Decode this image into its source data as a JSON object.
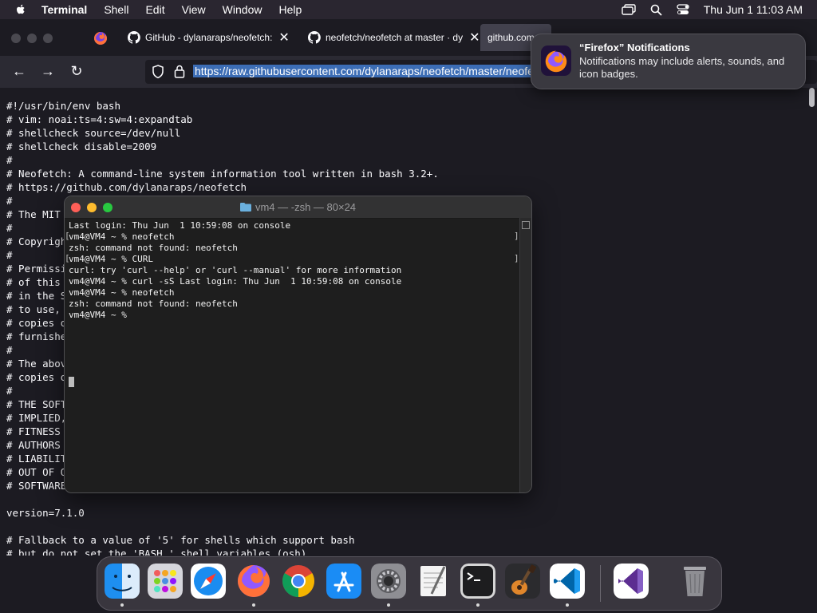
{
  "menubar": {
    "app": "Terminal",
    "items": [
      "Shell",
      "Edit",
      "View",
      "Window",
      "Help"
    ],
    "clock": "Thu Jun 1  11:03 AM"
  },
  "tabs": [
    {
      "label": "GitHub - dylanaraps/neofetch:",
      "active": false
    },
    {
      "label": "neofetch/neofetch at master · dy",
      "active": false
    },
    {
      "label": "github.com",
      "active": true
    }
  ],
  "nav": {
    "url": "https://raw.githubusercontent.com/dylanaraps/neofetch/master/neofetch"
  },
  "page": {
    "code": "#!/usr/bin/env bash\n# vim: noai:ts=4:sw=4:expandtab\n# shellcheck source=/dev/null\n# shellcheck disable=2009\n#\n# Neofetch: A command-line system information tool written in bash 3.2+.\n# https://github.com/dylanaraps/neofetch\n#\n# The MIT License (MIT)\n#\n# Copyright (c) 2015-2020 Dylan Araps\n#\n# Permission is hereby granted, free of charge, to any person obtaining a copy\n# of this software and associated documentation files (the \"Software\"), to deal\n# in the Software without restriction, including without limitation the rights\n# to use, copy, modify, merge, publish, distribute, sublicense, and/or sell\n# copies of the Software, and to permit persons to whom the Software is\n# furnished to do so, subject to the following conditions:\n#\n# The above copyright notice and this permission notice shall be included in all\n# copies or substantial portions of the Software.\n#\n# THE SOFTWARE IS PROVIDED \"AS IS\", WITHOUT WARRANTY OF ANY KIND, EXPRESS OR\n# IMPLIED, INCLUDING BUT NOT LIMITED TO THE WARRANTIES OF MERCHANTABILITY,\n# FITNESS FOR A PARTICULAR PURPOSE AND NONINFRINGEMENT. IN NO EVENT SHALL THE\n# AUTHORS OR COPYRIGHT HOLDERS BE LIABLE FOR ANY CLAIM, DAMAGES OR OTHER\n# LIABILITY, WHETHER IN AN ACTION OF CONTRACT, TORT OR OTHERWISE, ARISING FROM,\n# OUT OF OR IN CONNECTION WITH THE SOFTWARE OR THE USE OR OTHER DEALINGS IN THE\n# SOFTWARE.\n\nversion=7.1.0\n\n# Fallback to a value of '5' for shells which support bash\n# but do not set the 'BASH_' shell variables (osh)."
  },
  "notification": {
    "title": "“Firefox” Notifications",
    "body": "Notifications may include alerts, sounds, and icon badges."
  },
  "terminal": {
    "title": "vm4 — -zsh — 80×24",
    "output": "Last login: Thu Jun  1 10:59:08 on console\nvm4@VM4 ~ % neofetch\nzsh: command not found: neofetch\nvm4@VM4 ~ % CURL\ncurl: try 'curl --help' or 'curl --manual' for more information\nvm4@VM4 ~ % curl -sS Last login: Thu Jun  1 10:59:08 on console\nvm4@VM4 ~ % neofetch\nzsh: command not found: neofetch\nvm4@VM4 ~ %"
  },
  "dock": {
    "apps": [
      "finder-icon",
      "launchpad-icon",
      "safari-icon",
      "firefox-icon",
      "chrome-icon",
      "app-store-icon",
      "system-preferences-icon",
      "textedit-icon",
      "terminal-icon",
      "garageband-icon",
      "vscode-icon",
      "visual-studio-icon",
      "trash-icon"
    ]
  }
}
